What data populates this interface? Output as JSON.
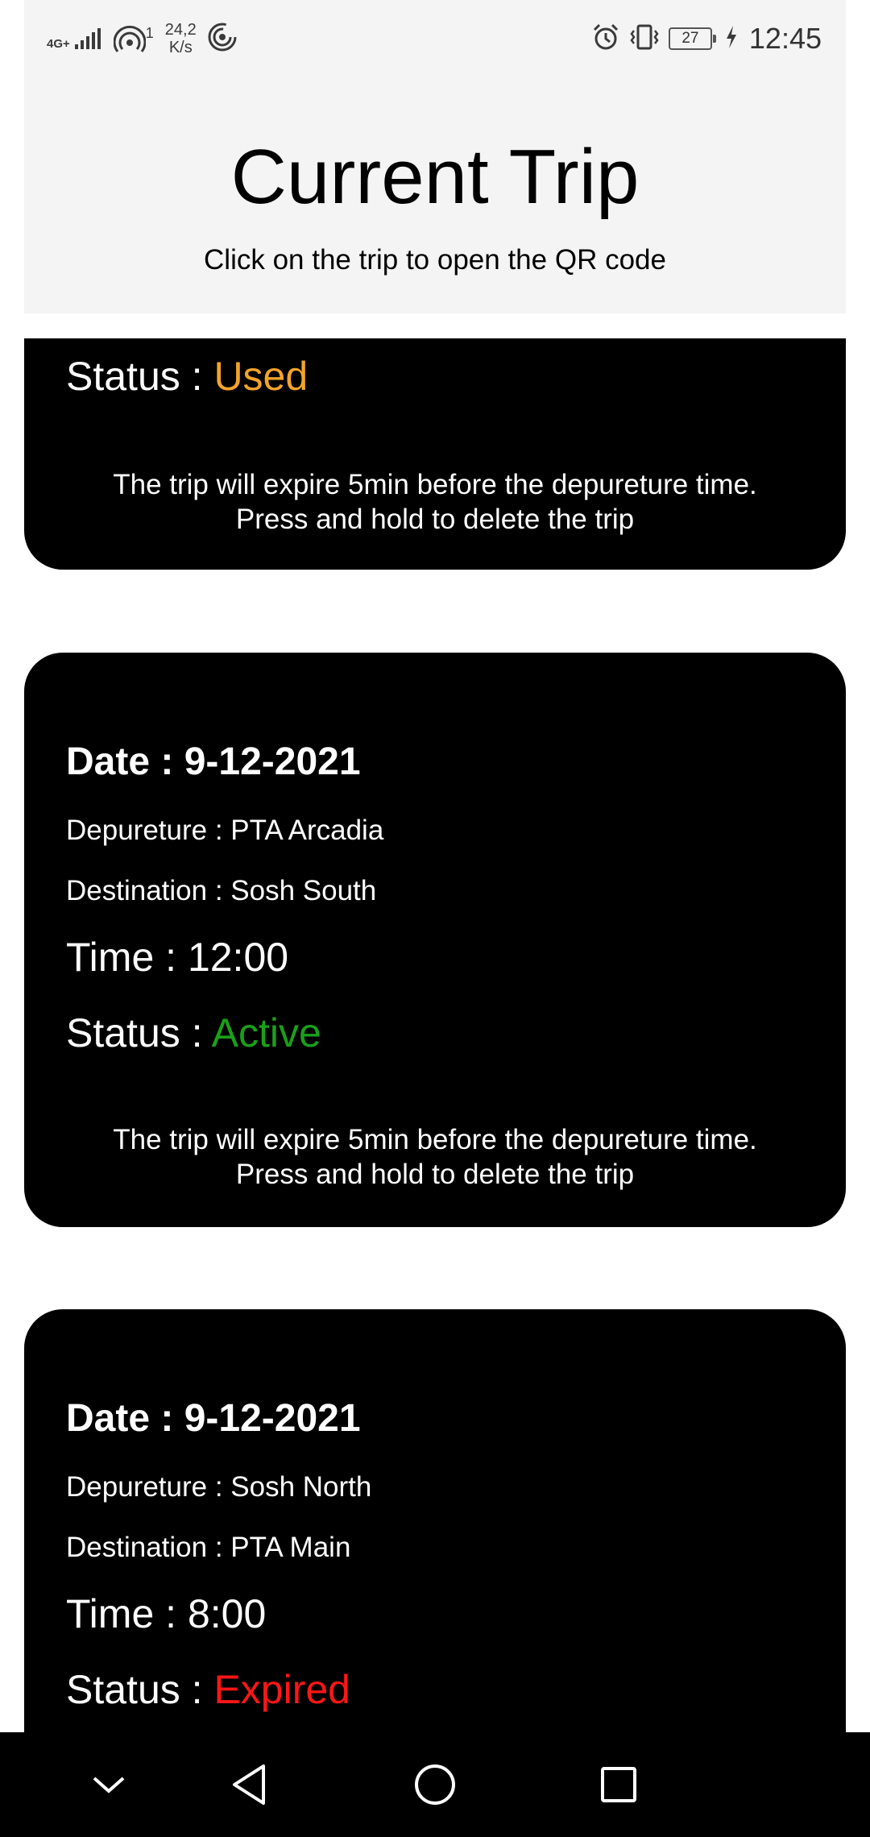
{
  "status_bar": {
    "network_type": "4G+",
    "hotspot_count": "1",
    "speed_value": "24,2",
    "speed_unit": "K/s",
    "battery": "27",
    "time": "12:45"
  },
  "header": {
    "title": "Current Trip",
    "subtitle": "Click on the trip to open the QR code"
  },
  "labels": {
    "date": "Date : ",
    "departure": "Depureture : ",
    "destination": "Destination : ",
    "time": "Time : ",
    "status": "Status : "
  },
  "trips": [
    {
      "status": "Used",
      "note_line1": "The trip will expire 5min before the depureture time.",
      "note_line2": "Press and hold to delete the trip"
    },
    {
      "date": "9-12-2021",
      "departure": "PTA Arcadia",
      "destination": "Sosh South",
      "time": "12:00",
      "status": "Active",
      "note_line1": "The trip will expire 5min before the depureture time.",
      "note_line2": "Press and hold to delete the trip"
    },
    {
      "date": "9-12-2021",
      "departure": "Sosh North",
      "destination": "PTA Main",
      "time": "8:00",
      "status": "Expired"
    }
  ],
  "colors": {
    "used": "#f2a42a",
    "active": "#1aa01a",
    "expired": "#ff1616"
  },
  "nav": {
    "icons": [
      "chevron-down-icon",
      "back-icon",
      "home-icon",
      "recents-icon"
    ]
  }
}
